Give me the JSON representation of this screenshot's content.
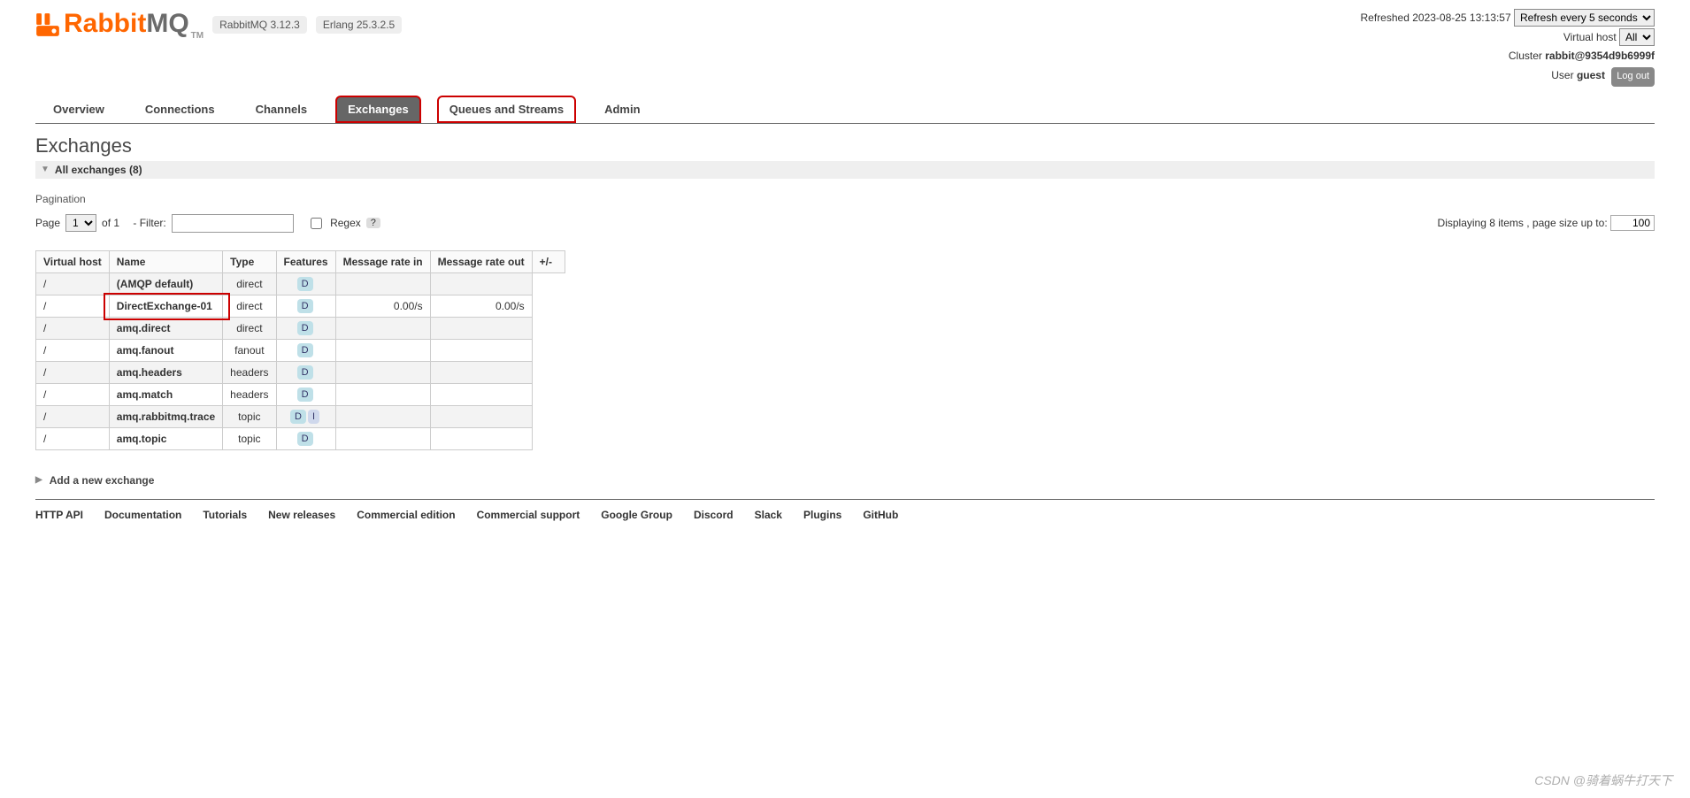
{
  "header": {
    "logo_primary": "Rabbit",
    "logo_secondary": "MQ",
    "tm": "TM",
    "version_badge": "RabbitMQ 3.12.3",
    "erlang_badge": "Erlang 25.3.2.5"
  },
  "status": {
    "refreshed_label": "Refreshed 2023-08-25 13:13:57",
    "refresh_select": "Refresh every 5 seconds",
    "vhost_label": "Virtual host",
    "vhost_select": "All",
    "cluster_label": "Cluster",
    "cluster_name": "rabbit@9354d9b6999f",
    "user_label": "User",
    "user_name": "guest",
    "logout": "Log out"
  },
  "tabs": [
    {
      "label": "Overview",
      "active": false,
      "highlight": false
    },
    {
      "label": "Connections",
      "active": false,
      "highlight": false
    },
    {
      "label": "Channels",
      "active": false,
      "highlight": false
    },
    {
      "label": "Exchanges",
      "active": true,
      "highlight": true
    },
    {
      "label": "Queues and Streams",
      "active": false,
      "highlight": true
    },
    {
      "label": "Admin",
      "active": false,
      "highlight": false
    }
  ],
  "page_title": "Exchanges",
  "section": {
    "all_exchanges": "All exchanges (8)"
  },
  "pagination": {
    "section_label": "Pagination",
    "page_label": "Page",
    "page_select": "1",
    "of_text": "of 1",
    "filter_label": "- Filter:",
    "regex_label": "Regex",
    "qmark": "?",
    "display_text": "Displaying 8 items , page size up to:",
    "page_size": "100"
  },
  "table": {
    "headers": {
      "vhost": "Virtual host",
      "name": "Name",
      "type": "Type",
      "features": "Features",
      "rate_in": "Message rate in",
      "rate_out": "Message rate out",
      "pm": "+/-"
    },
    "rows": [
      {
        "vhost": "/",
        "name": "(AMQP default)",
        "type": "direct",
        "features": [
          "D"
        ],
        "rate_in": "",
        "rate_out": "",
        "highlight": false
      },
      {
        "vhost": "/",
        "name": "DirectExchange-01",
        "type": "direct",
        "features": [
          "D"
        ],
        "rate_in": "0.00/s",
        "rate_out": "0.00/s",
        "highlight": true
      },
      {
        "vhost": "/",
        "name": "amq.direct",
        "type": "direct",
        "features": [
          "D"
        ],
        "rate_in": "",
        "rate_out": "",
        "highlight": false
      },
      {
        "vhost": "/",
        "name": "amq.fanout",
        "type": "fanout",
        "features": [
          "D"
        ],
        "rate_in": "",
        "rate_out": "",
        "highlight": false
      },
      {
        "vhost": "/",
        "name": "amq.headers",
        "type": "headers",
        "features": [
          "D"
        ],
        "rate_in": "",
        "rate_out": "",
        "highlight": false
      },
      {
        "vhost": "/",
        "name": "amq.match",
        "type": "headers",
        "features": [
          "D"
        ],
        "rate_in": "",
        "rate_out": "",
        "highlight": false
      },
      {
        "vhost": "/",
        "name": "amq.rabbitmq.trace",
        "type": "topic",
        "features": [
          "D",
          "I"
        ],
        "rate_in": "",
        "rate_out": "",
        "highlight": false
      },
      {
        "vhost": "/",
        "name": "amq.topic",
        "type": "topic",
        "features": [
          "D"
        ],
        "rate_in": "",
        "rate_out": "",
        "highlight": false
      }
    ]
  },
  "add_new": "Add a new exchange",
  "footer": [
    "HTTP API",
    "Documentation",
    "Tutorials",
    "New releases",
    "Commercial edition",
    "Commercial support",
    "Google Group",
    "Discord",
    "Slack",
    "Plugins",
    "GitHub"
  ],
  "watermark": "CSDN @骑着蜗牛打天下"
}
